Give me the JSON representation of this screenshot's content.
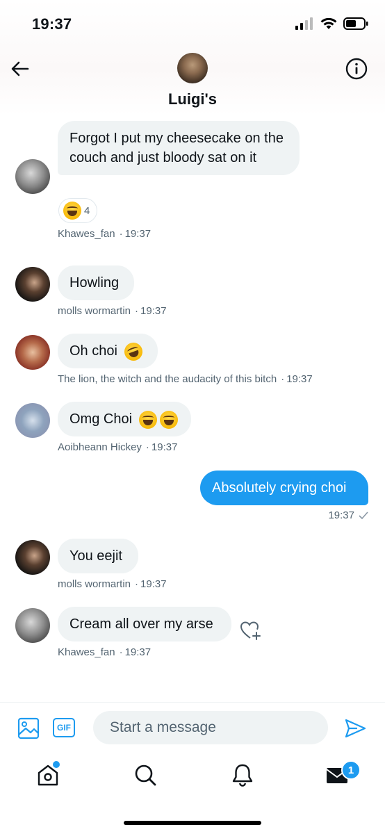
{
  "status_bar": {
    "time": "19:37"
  },
  "header": {
    "title": "Luigi's"
  },
  "messages": [
    {
      "text": "Forgot I put my cheesecake on the couch and just bloody sat on it",
      "sender": "Khawes_fan",
      "time": "19:37",
      "reaction_count": "4"
    },
    {
      "text": "Howling",
      "sender": "molls wormartin",
      "time": "19:37"
    },
    {
      "text": "Oh choi",
      "sender": "The lion, the witch and the audacity of this bitch",
      "time": "19:37"
    },
    {
      "text": "Omg Choi",
      "sender": "Aoibheann Hickey",
      "time": "19:37"
    },
    {
      "text": "Absolutely crying choi",
      "time": "19:37",
      "outgoing": true
    },
    {
      "text": "You eejit",
      "sender": "molls wormartin",
      "time": "19:37"
    },
    {
      "text": "Cream all over my arse",
      "sender": "Khawes_fan",
      "time": "19:37"
    }
  ],
  "composer": {
    "placeholder": "Start a message",
    "gif_label": "GIF"
  },
  "tab_bar": {
    "messages_badge": "1"
  },
  "colors": {
    "accent": "#1d9bf0",
    "bubble": "#eff3f4",
    "meta": "#536471"
  },
  "icons": [
    "back-arrow-icon",
    "info-icon",
    "laughing-tears-emoji-icon",
    "rofl-emoji-icon",
    "heart-plus-icon",
    "image-icon",
    "gif-icon",
    "send-icon",
    "home-icon",
    "search-icon",
    "bell-icon",
    "mail-icon"
  ]
}
